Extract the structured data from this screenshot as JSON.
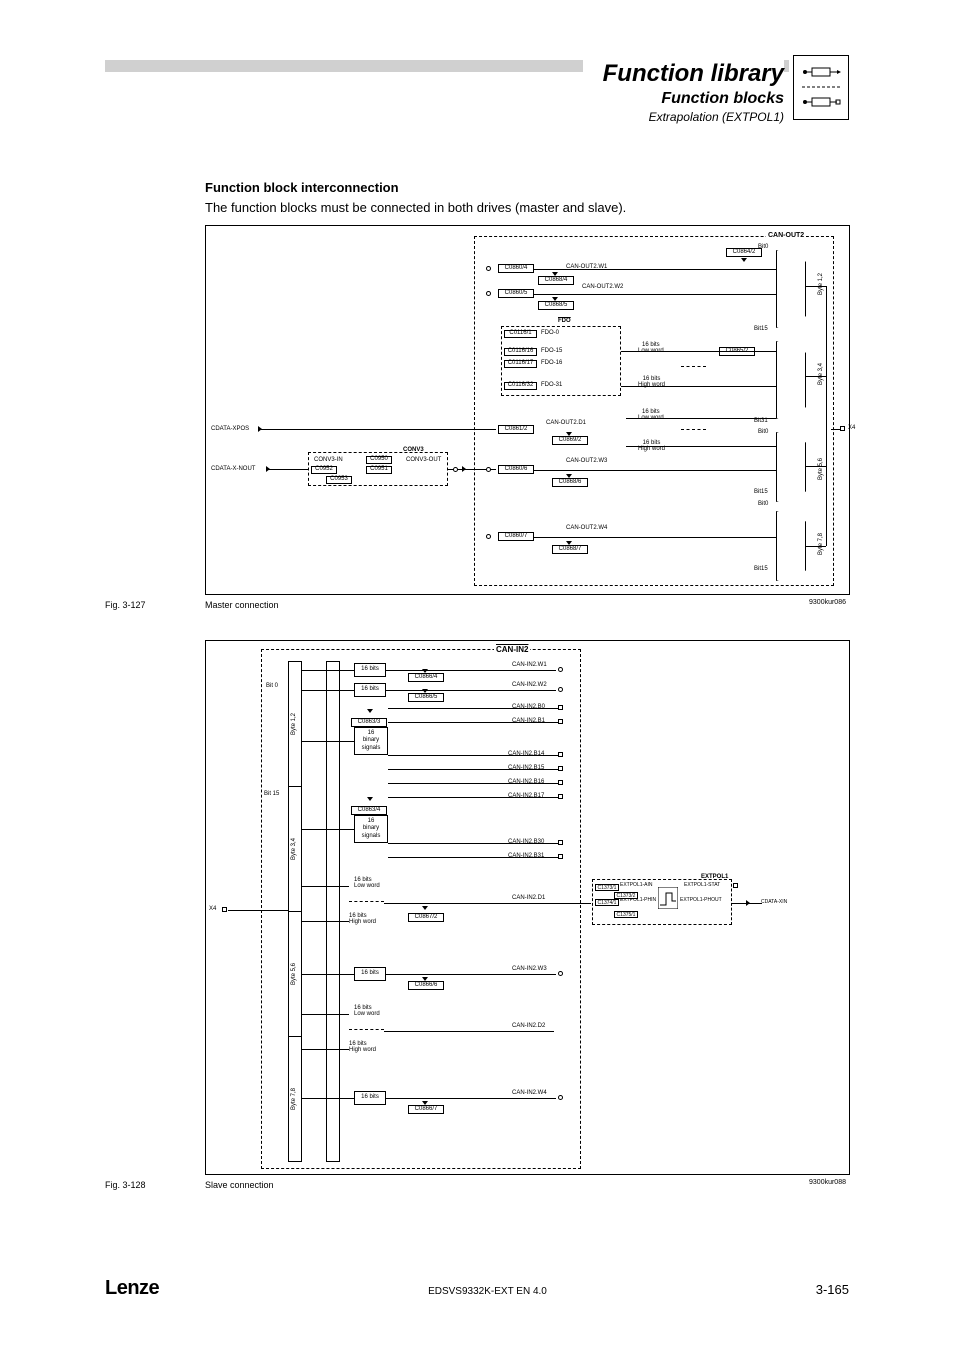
{
  "header": {
    "title": "Function library",
    "subtitle": "Function blocks",
    "subtitle2": "Extrapolation (EXTPOL1)"
  },
  "section": {
    "heading": "Function block interconnection",
    "text": "The function blocks must be connected in both drives (master and slave)."
  },
  "fig1": {
    "label": "Fig. 3-127",
    "caption": "Master connection",
    "id": "9300kur086",
    "in_xpos": "CDATA-XPOS",
    "in_nout": "CDATA-X-NOUT",
    "conv3": {
      "title": "CONV3",
      "in": "CONV3-IN",
      "out": "CONV3-OUT",
      "c0950": "C0950",
      "c0951": "C0951",
      "c0952": "C0952",
      "c0953": "C0953"
    },
    "canout2": {
      "title": "CAN-OUT2",
      "w1": "CAN-OUT2.W1",
      "w2": "CAN-OUT2.W2",
      "w3": "CAN-OUT2.W3",
      "w4": "CAN-OUT2.W4",
      "d1": "CAN-OUT2.D1",
      "c0860_4": "C0860/4",
      "c0868_4": "C0868/4",
      "c0860_5": "C0860/5",
      "c0868_5": "C0868/5",
      "c0861_2": "C0861/2",
      "c0869_2": "C0869/2",
      "c0860_6": "C0860/6",
      "c0868_6": "C0868/6",
      "c0860_7": "C0860/7",
      "c0868_7": "C0868/7",
      "c0864_2": "C0864/2",
      "c0865_2": "C0865/2",
      "byte12": "Byte 1,2",
      "byte34": "Byte 3,4",
      "byte56": "Byte 5,6",
      "byte78": "Byte 7,8",
      "bit0": "Bit0",
      "bit15": "Bit15",
      "bit31": "Bit31",
      "low": "16 bits\nLow word",
      "high": "16 bits\nHigh word",
      "x4": "X4"
    },
    "fdo": {
      "title": "FDO",
      "c0116_1": "C0116/1",
      "l0": "FDO-0",
      "c0116_16": "C0116/16",
      "l15": "FDO-15",
      "c0116_17": "C0116/17",
      "l16": "FDO-16",
      "c0116_32": "C0116/32",
      "l31": "FDO-31"
    }
  },
  "fig2": {
    "label": "Fig. 3-128",
    "caption": "Slave connection",
    "id": "9300kur088",
    "x4": "X4",
    "canin2": {
      "title": "CAN-IN2",
      "w1": "CAN-IN2.W1",
      "w2": "CAN-IN2.W2",
      "w3": "CAN-IN2.W3",
      "w4": "CAN-IN2.W4",
      "d1": "CAN-IN2.D1",
      "d2": "CAN-IN2.D2",
      "b0": "CAN-IN2.B0",
      "b1": "CAN-IN2.B1",
      "b14": "CAN-IN2.B14",
      "b15": "CAN-IN2.B15",
      "b16": "CAN-IN2.B16",
      "b17": "CAN-IN2.B17",
      "b30": "CAN-IN2.B30",
      "b31": "CAN-IN2.B31",
      "c0866_4": "C0866/4",
      "c0866_5": "C0866/5",
      "c0866_6": "C0866/6",
      "c0866_7": "C0866/7",
      "c0863_3": "C0863/3",
      "c0863_4": "C0863/4",
      "c0867_2": "C0867/2",
      "bit0": "Bit 0",
      "bit15": "Bit 15",
      "byte12": "Byte 1,2",
      "byte34": "Byte 3,4",
      "byte56": "Byte 5,6",
      "byte78": "Byte 7,8",
      "bits16": "16 bits",
      "bin16": "16\nbinary\nsignals",
      "low": "16 bits\nLow word",
      "high": "16 bits\nHigh word"
    },
    "extpol1": {
      "title": "EXTPOL1",
      "ain": "EXTPOL1-AIN",
      "phin": "EXTPOL1-PHIN",
      "stat": "EXTPOL1-STAT",
      "phout": "EXTPOL1-PHOUT",
      "c1373_1": "C1373/1",
      "c1374_1": "C1374/1",
      "c1373_2": "C1373/2",
      "c1375_1": "C1375/1",
      "out": "CDATA-XIN"
    }
  },
  "footer": {
    "brand": "Lenze",
    "doc": "EDSVS9332K-EXT EN 4.0",
    "page": "3-165"
  }
}
